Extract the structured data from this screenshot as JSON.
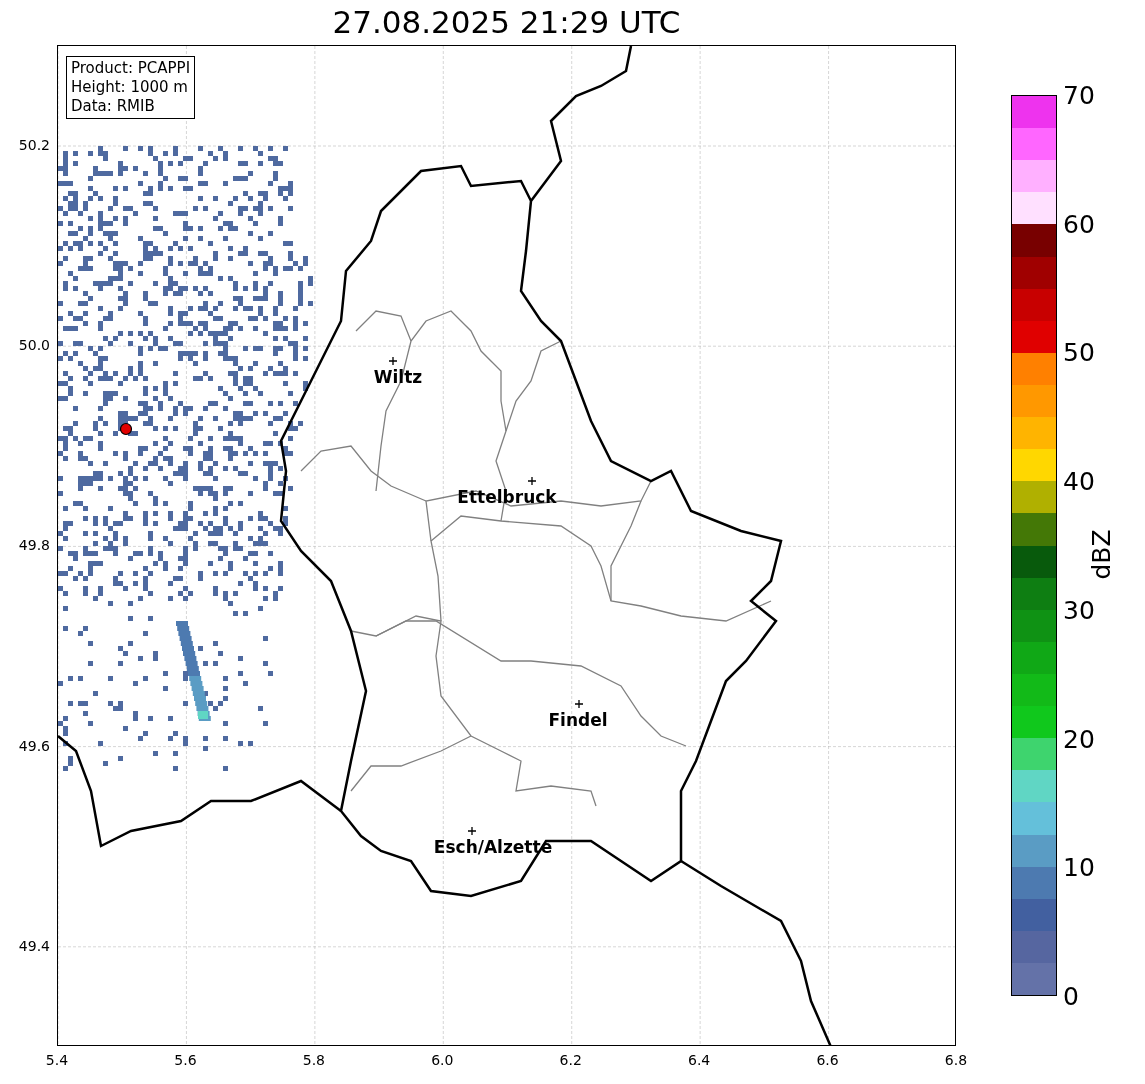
{
  "title": "27.08.2025 21:29 UTC",
  "info_box": [
    "Product: PCAPPI",
    "Height: 1000 m",
    "Data: RMIB"
  ],
  "map": {
    "y_ticks": [
      "50.2",
      "50.0",
      "49.8",
      "49.6",
      "49.4"
    ],
    "x_ticks": [
      "5.4",
      "5.6",
      "5.8",
      "6.0",
      "6.2",
      "6.4",
      "6.6",
      "6.8"
    ],
    "cities": [
      {
        "name": "Wiltz"
      },
      {
        "name": "Ettelbruck"
      },
      {
        "name": "Findel"
      },
      {
        "name": "Esch/Alzette"
      }
    ]
  },
  "colorbar": {
    "label": "dBZ",
    "ticks": [
      "70",
      "60",
      "50",
      "40",
      "30",
      "20",
      "10",
      "0"
    ],
    "bands": [
      {
        "color": "#6472a8"
      },
      {
        "color": "#5666a0"
      },
      {
        "color": "#4260a0"
      },
      {
        "color": "#4d7ab0"
      },
      {
        "color": "#5a9cc4"
      },
      {
        "color": "#64c0da"
      },
      {
        "color": "#60d6c4"
      },
      {
        "color": "#3ed46e"
      },
      {
        "color": "#10c81c"
      },
      {
        "color": "#12ba18"
      },
      {
        "color": "#10a816"
      },
      {
        "color": "#0f9214"
      },
      {
        "color": "#0e7e12"
      },
      {
        "color": "#085a0c"
      },
      {
        "color": "#447806"
      },
      {
        "color": "#b0b000"
      },
      {
        "color": "#ffd700"
      },
      {
        "color": "#ffb400"
      },
      {
        "color": "#ff9800"
      },
      {
        "color": "#ff8000"
      },
      {
        "color": "#e00000"
      },
      {
        "color": "#c80000"
      },
      {
        "color": "#a00000"
      },
      {
        "color": "#780000"
      },
      {
        "color": "#ffe0ff"
      },
      {
        "color": "#ffb0ff"
      },
      {
        "color": "#ff66ff"
      },
      {
        "color": "#ee33ee"
      }
    ]
  }
}
